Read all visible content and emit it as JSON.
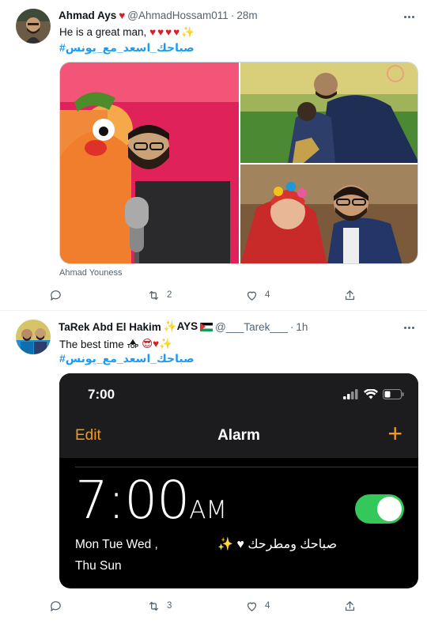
{
  "tweets": [
    {
      "name": "Ahmad Ays",
      "name_emoji": "♥",
      "handle": "@AhmadHossam011",
      "separator": "·",
      "time": "28m",
      "text": "He is a great man,",
      "text_emoji": "♥♥♥♥✨",
      "hashtag": "#صباحك_اسعد_مع_يونس",
      "media_caption": "Ahmad Youness",
      "reply_count": "",
      "retweet_count": "2",
      "like_count": "4"
    },
    {
      "name": "TaRek Abd El Hakim",
      "name_emoji": "✨AYS",
      "handle": "@___Tarek___",
      "separator": "·",
      "time": "1h",
      "text": "The best time",
      "text_emoji": "😎♥✨",
      "hashtag": "#صباحك_اسعد_مع_يونس",
      "reply_count": "",
      "retweet_count": "3",
      "like_count": "4",
      "phone": {
        "status_time": "7:00",
        "edit": "Edit",
        "title": "Alarm",
        "plus": "+",
        "alarm_time": "7:00",
        "alarm_ampm": "AM",
        "days_line1": "Mon Tue Wed ,",
        "alarm_label": "صباحك ومطرحك ♥ ✨",
        "days_line2": "Thu Sun",
        "toggle_on": true
      }
    }
  ],
  "colors": {
    "accent": "#1d9bf0",
    "heart": "#d4222c",
    "ios_orange": "#f29a1f",
    "ios_green": "#34c759",
    "muted": "#536471"
  }
}
